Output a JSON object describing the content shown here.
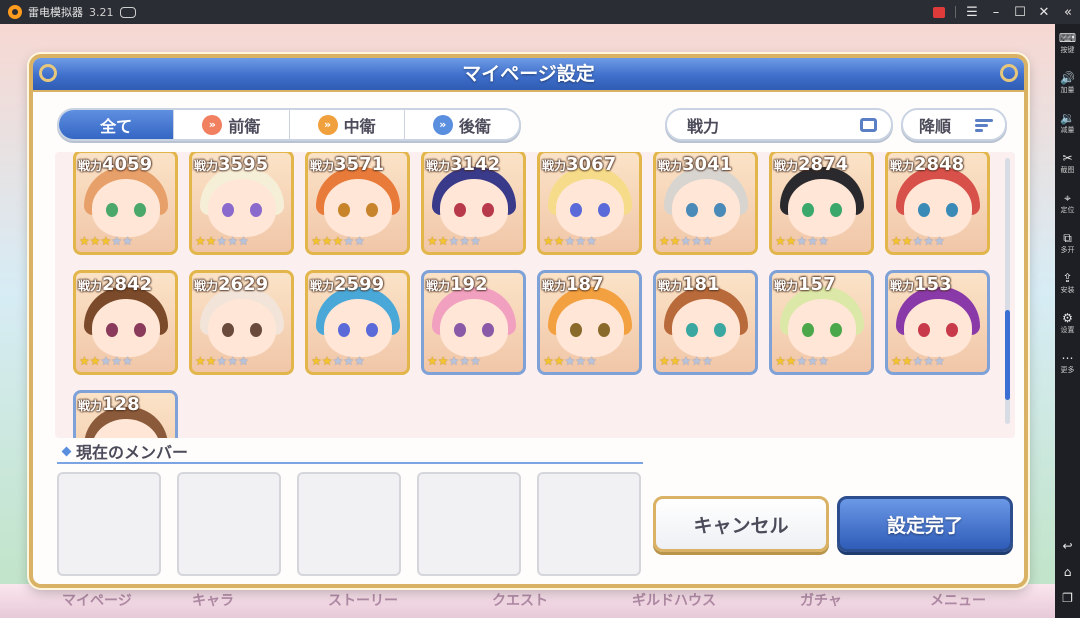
{
  "emulator": {
    "title": "雷电模拟器",
    "version": "3.21",
    "sidebar_items": [
      {
        "icon": "keyboard-icon",
        "glyph": "⌨",
        "label": "按键"
      },
      {
        "icon": "volume-up-icon",
        "glyph": "🔊",
        "label": "加量"
      },
      {
        "icon": "volume-down-icon",
        "glyph": "🔉",
        "label": "减量"
      },
      {
        "icon": "scissors-icon",
        "glyph": "✂",
        "label": "截图"
      },
      {
        "icon": "location-icon",
        "glyph": "⌖",
        "label": "定位"
      },
      {
        "icon": "multi-window-icon",
        "glyph": "⧉",
        "label": "多开"
      },
      {
        "icon": "install-apk-icon",
        "glyph": "⇪",
        "label": "安装"
      },
      {
        "icon": "settings-gear-icon",
        "glyph": "⚙",
        "label": "设置"
      },
      {
        "icon": "more-dots-icon",
        "glyph": "⋯",
        "label": "更多"
      }
    ]
  },
  "background_nav": [
    "マイページ",
    "キャラ",
    "ストーリー",
    "クエスト",
    "ギルドハウス",
    "ガチャ",
    "メニュー"
  ],
  "dialog": {
    "title": "マイページ設定",
    "tabs": [
      {
        "label": "全て",
        "active": true,
        "icon": ""
      },
      {
        "label": "前衛",
        "active": false,
        "icon": "chevron-front-icon"
      },
      {
        "label": "中衛",
        "active": false,
        "icon": "chevron-middle-icon"
      },
      {
        "label": "後衛",
        "active": false,
        "icon": "chevron-back-icon"
      }
    ],
    "sort_label": "戦力",
    "order_label": "降順",
    "power_prefix": "戦力",
    "characters": [
      {
        "power": "4059",
        "stars": 3,
        "frame": "gold",
        "hair": "#e8a06a",
        "eyes": "#4aa86a"
      },
      {
        "power": "3595",
        "stars": 2,
        "frame": "gold",
        "hair": "#f6efd8",
        "eyes": "#8a6acd"
      },
      {
        "power": "3571",
        "stars": 3,
        "frame": "gold",
        "hair": "#e87a3a",
        "eyes": "#c8842a"
      },
      {
        "power": "3142",
        "stars": 2,
        "frame": "gold",
        "hair": "#3a3a8a",
        "eyes": "#b83a4a"
      },
      {
        "power": "3067",
        "stars": 2,
        "frame": "gold",
        "hair": "#f6dc8a",
        "eyes": "#5a6ad8"
      },
      {
        "power": "3041",
        "stars": 2,
        "frame": "gold",
        "hair": "#d8d4d0",
        "eyes": "#4a8ab8"
      },
      {
        "power": "2874",
        "stars": 2,
        "frame": "gold",
        "hair": "#2a2a2e",
        "eyes": "#3aa86a"
      },
      {
        "power": "2848",
        "stars": 2,
        "frame": "gold",
        "hair": "#d8504a",
        "eyes": "#3a8ab8"
      },
      {
        "power": "2842",
        "stars": 2,
        "frame": "gold",
        "hair": "#7a4a2a",
        "eyes": "#8a3a5a"
      },
      {
        "power": "2629",
        "stars": 2,
        "frame": "gold",
        "hair": "#f2e4d8",
        "eyes": "#6a4a3a"
      },
      {
        "power": "2599",
        "stars": 2,
        "frame": "gold",
        "hair": "#4aa8d8",
        "eyes": "#5a6ad8"
      },
      {
        "power": "192",
        "stars": 2,
        "frame": "blue",
        "hair": "#f2a0c0",
        "eyes": "#8a5aa8"
      },
      {
        "power": "187",
        "stars": 2,
        "frame": "blue",
        "hair": "#f2a040",
        "eyes": "#8a6a2a"
      },
      {
        "power": "181",
        "stars": 2,
        "frame": "blue",
        "hair": "#b86a3a",
        "eyes": "#3aa8a0"
      },
      {
        "power": "157",
        "stars": 2,
        "frame": "blue",
        "hair": "#dce8a8",
        "eyes": "#4aa84a"
      },
      {
        "power": "153",
        "stars": 2,
        "frame": "blue",
        "hair": "#8a3aa8",
        "eyes": "#c83a4a"
      },
      {
        "power": "128",
        "stars": 2,
        "frame": "blue",
        "hair": "#8a5a3a",
        "eyes": "#6a4a3a"
      }
    ],
    "member_section_title": "現在のメンバー",
    "member_slots": 5,
    "scroll_position": 0.55,
    "cancel_label": "キャンセル",
    "confirm_label": "設定完了"
  },
  "colors": {
    "header_blue": "#3f6fcb",
    "gold_frame": "#e2b64a",
    "blue_frame": "#7ea2d8",
    "star_on": "#f4c430",
    "star_off": "#b8c4dc"
  }
}
